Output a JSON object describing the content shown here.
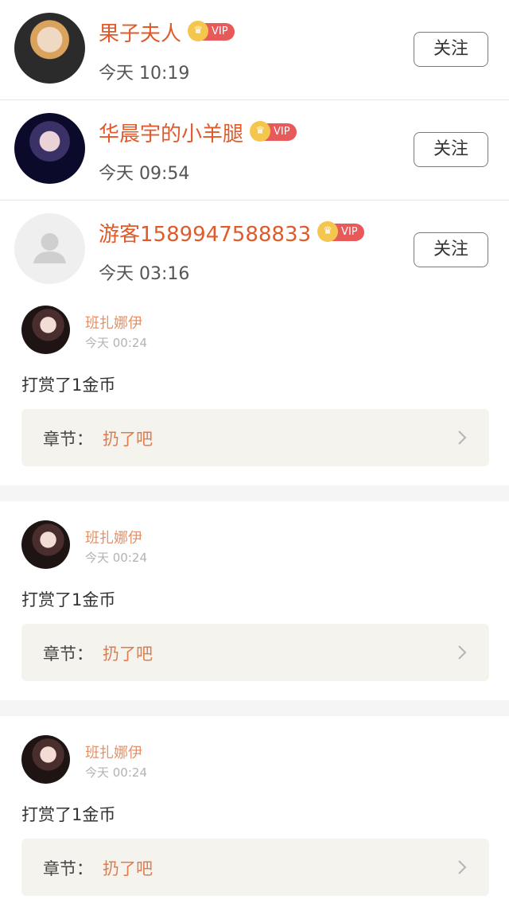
{
  "followers": [
    {
      "name": "果子夫人",
      "vip": "VIP",
      "time": "今天 10:19",
      "follow_label": "关注"
    },
    {
      "name": "华晨宇的小羊腿",
      "vip": "VIP",
      "time": "今天 09:54",
      "follow_label": "关注"
    },
    {
      "name": "游客1589947588833",
      "vip": "VIP",
      "time": "今天 03:16",
      "follow_label": "关注"
    }
  ],
  "rewards": [
    {
      "name": "班扎娜伊",
      "time": "今天 00:24",
      "content": "打赏了1金币",
      "chapter_label": "章节：",
      "chapter_title": "扔了吧"
    },
    {
      "name": "班扎娜伊",
      "time": "今天 00:24",
      "content": "打赏了1金币",
      "chapter_label": "章节：",
      "chapter_title": "扔了吧"
    },
    {
      "name": "班扎娜伊",
      "time": "今天 00:24",
      "content": "打赏了1金币",
      "chapter_label": "章节：",
      "chapter_title": "扔了吧"
    }
  ],
  "colors": {
    "name_accent": "#e05a2a",
    "vip_badge": "#e85a5a",
    "crown": "#f5c64d",
    "reward_name": "#e0926a",
    "chapter_title": "#e07b4a",
    "chapter_bg": "#f4f3ee"
  },
  "icons": {
    "crown": "crown-icon",
    "guest_avatar": "user-placeholder-icon",
    "chevron": "chevron-right-icon"
  }
}
